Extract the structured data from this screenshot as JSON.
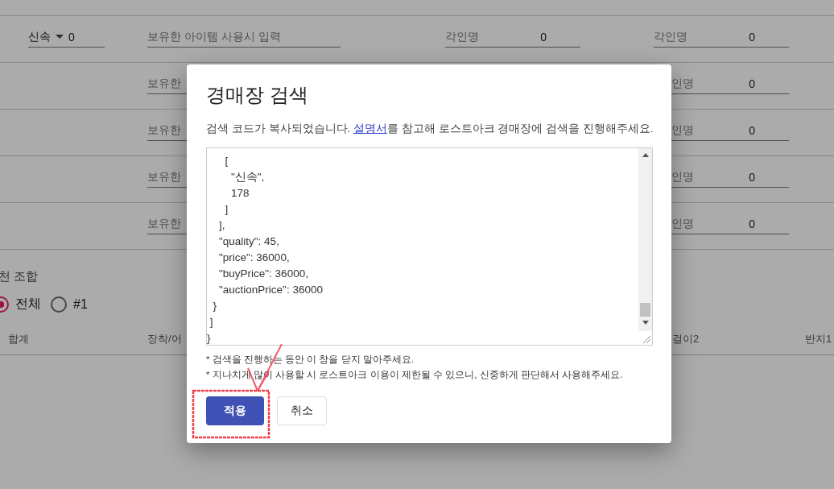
{
  "page": {
    "rows": [
      {
        "stat": {
          "label": "신속",
          "value": "0"
        },
        "item": {
          "placeholder": "보유한 아이템 사용시 입력"
        },
        "engravings": [
          {
            "label": "각인명",
            "value": "0"
          },
          {
            "label": "각인명",
            "value": "0"
          }
        ]
      },
      {
        "item": {
          "placeholder": "보유한"
        },
        "engravings": [
          {
            "label": "인명",
            "value": "0"
          }
        ]
      },
      {
        "item": {
          "placeholder": "보유한"
        },
        "engravings": [
          {
            "label": "인명",
            "value": "0"
          }
        ]
      },
      {
        "item": {
          "placeholder": "보유한"
        },
        "engravings": [
          {
            "label": "인명",
            "value": "0"
          }
        ]
      },
      {
        "item": {
          "placeholder": "보유한"
        },
        "engravings": [
          {
            "label": "인명",
            "value": "0"
          }
        ]
      }
    ],
    "section_title": "천 조합",
    "radios": [
      {
        "label": "전체",
        "selected": true
      },
      {
        "label": "#1",
        "selected": false
      }
    ],
    "columns": [
      "합계",
      "장착/어",
      "걸이2",
      "반지1"
    ]
  },
  "dialog": {
    "title": "경매장 검색",
    "description": {
      "before": "검색 코드가 복사되었습니다. ",
      "link": "설명서",
      "after": "를 참고해 로스트아크 경매장에 검색을 진행해주세요."
    },
    "code": "      [\n        \"신속\",\n        178\n      ]\n    ],\n    \"quality\": 45,\n    \"price\": 36000,\n    \"buyPrice\": 36000,\n    \"auctionPrice\": 36000\n  }\n ]\n}",
    "notes": [
      "* 검색을 진행하는 동안 이 창을 닫지 말아주세요.",
      "* 지나치게 많이 사용할 시 로스트아크 이용이 제한될 수 있으니, 신중하게 판단해서 사용해주세요."
    ],
    "buttons": [
      {
        "label": "적용",
        "kind": "primary"
      },
      {
        "label": "취소",
        "kind": "secondary"
      }
    ]
  }
}
